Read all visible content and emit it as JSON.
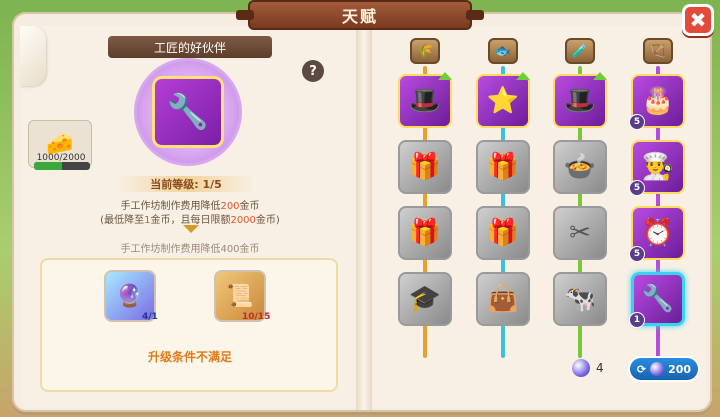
{
  "window": {
    "title": "天赋",
    "close_label": "✖"
  },
  "talent": {
    "name": "工匠的好伙伴",
    "help_label": "?",
    "icon": "wrench-heart-icon",
    "level_text": "当前等级: 1/5",
    "desc_line1_pre": "手工作坊制作费用降低",
    "desc_line1_val": "200",
    "desc_line1_post": "金币",
    "desc_line2_pre": "(最低降至",
    "desc_line2_val1": "1",
    "desc_line2_mid": "金币，且每日限额",
    "desc_line2_val2": "2000",
    "desc_line2_post": "金币)",
    "next_desc": "手工作坊制作费用降低400金币"
  },
  "resource": {
    "icon": "cheese-wheel-icon",
    "count_text": "1000/2000",
    "progress": 0.5,
    "color": "#3aa83a"
  },
  "upgrade_cost": {
    "items": [
      {
        "icon": "crystal-orb-icon",
        "count": "4/1",
        "color": "#1f3a8a"
      },
      {
        "icon": "scroll-icon",
        "count": "10/15",
        "color": "#c42a2a"
      }
    ],
    "condition_text": "升级条件不满足"
  },
  "talent_tree": {
    "categories": [
      {
        "icon": "wheat-icon",
        "glyph": "🌾"
      },
      {
        "icon": "fish-icon",
        "glyph": "🐟"
      },
      {
        "icon": "potion-icon",
        "glyph": "🧪"
      },
      {
        "icon": "arrow-sign-icon",
        "glyph": "🏹"
      }
    ],
    "column_colors": [
      "#e6a12b",
      "#3cc0e0",
      "#7cc63a",
      "#b34fd8"
    ],
    "rows": [
      [
        {
          "icon": "witch-hat-icon",
          "glyph": "🎩",
          "state": "active",
          "upgradable": true
        },
        {
          "icon": "star-icon",
          "glyph": "⭐",
          "state": "active",
          "upgradable": true
        },
        {
          "icon": "witch-hat-icon",
          "glyph": "🎩",
          "state": "active",
          "upgradable": true
        },
        {
          "icon": "cake-icon",
          "glyph": "🎂",
          "state": "active",
          "level": "5"
        }
      ],
      [
        {
          "icon": "gift-bag-icon",
          "glyph": "🎁",
          "state": "locked"
        },
        {
          "icon": "gift-bag-icon",
          "glyph": "🎁",
          "state": "locked"
        },
        {
          "icon": "pot-icon",
          "glyph": "🍲",
          "state": "locked"
        },
        {
          "icon": "chef-hat-icon",
          "glyph": "👨‍🍳",
          "state": "active",
          "level": "5"
        }
      ],
      [
        {
          "icon": "gift-bag-icon",
          "glyph": "🎁",
          "state": "locked"
        },
        {
          "icon": "gift-bag-icon",
          "glyph": "🎁",
          "state": "locked"
        },
        {
          "icon": "shears-icon",
          "glyph": "✂",
          "state": "locked"
        },
        {
          "icon": "clock-icon",
          "glyph": "⏰",
          "state": "active",
          "level": "5"
        }
      ],
      [
        {
          "icon": "graduation-cap-icon",
          "glyph": "🎓",
          "state": "locked"
        },
        {
          "icon": "bag-icon",
          "glyph": "👜",
          "state": "locked"
        },
        {
          "icon": "cow-icon",
          "glyph": "🐄",
          "state": "locked"
        },
        {
          "icon": "wrench-heart-icon",
          "glyph": "🔧",
          "state": "active",
          "level": "1",
          "selected": true
        }
      ]
    ]
  },
  "footer": {
    "gem_count": "4",
    "reset_cost": "200",
    "reset_icon": "refresh-icon"
  }
}
